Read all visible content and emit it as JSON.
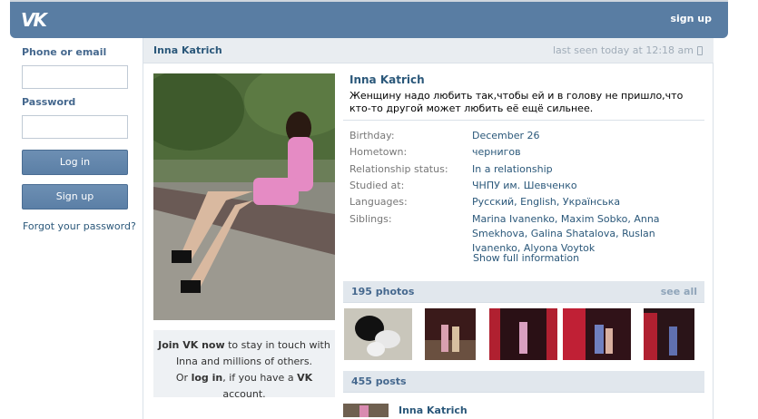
{
  "header": {
    "logo": "VK",
    "signup_label": "sign up"
  },
  "login": {
    "phone_label": "Phone or email",
    "password_label": "Password",
    "login_button": "Log in",
    "signup_button": "Sign up",
    "forgot_link": "Forgot your password?"
  },
  "profile_header": {
    "name": "Inna Katrich",
    "last_seen": "last seen today at 12:18 am"
  },
  "join": {
    "line1_bold": "Join VK now",
    "line1_rest": " to stay in touch with",
    "line2": "Inna and millions of others.",
    "line3_pre": "Or ",
    "line3_link": "log in",
    "line3_mid": ", if you have a ",
    "line3_bold": "VK",
    "line3_end": " account."
  },
  "profile": {
    "name": "Inna Katrich",
    "status": "Женщину надо любить так,чтобы ей и в голову не пришло,что кто-то другой может любить её ещё сильнее.",
    "info": [
      {
        "key": "Birthday:",
        "value": "December 26"
      },
      {
        "key": "Hometown:",
        "value": "чернигов"
      },
      {
        "key": "Relationship status:",
        "value": "In a relationship"
      },
      {
        "key": "Studied at:",
        "value": "ЧНПУ им. Шевченко"
      },
      {
        "key": "Languages:",
        "value": "Русский, English, Українська"
      },
      {
        "key": "Siblings:",
        "value": "Marina Ivanenko, Maxim Sobko, Anna Smekhova, Galina Shatalova, Ruslan Ivanenko, Alyona Voytok"
      }
    ],
    "show_full": "Show full information"
  },
  "photos": {
    "title": "195 photos",
    "see_all": "see all"
  },
  "posts": {
    "title": "455 posts",
    "author": "Inna Katrich"
  },
  "colors": {
    "brand": "#597da3",
    "link": "#2b587a",
    "section_bg": "#e1e7ed"
  }
}
